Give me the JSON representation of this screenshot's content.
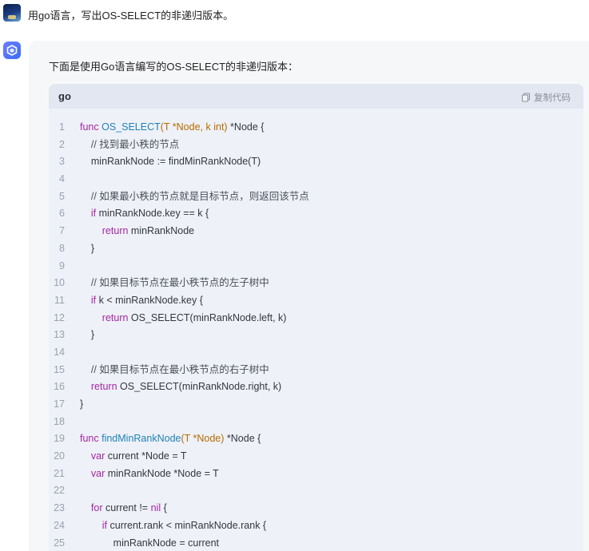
{
  "user": {
    "message": "用go语言，写出OS-SELECT的非递归版本。"
  },
  "assistant": {
    "intro": "下面是使用Go语言编写的OS-SELECT的非递归版本："
  },
  "code": {
    "language": "go",
    "copy_label": "复制代码",
    "lines": [
      {
        "n": "1",
        "tokens": [
          [
            "kw",
            "func "
          ],
          [
            "fn",
            "OS_SELECT"
          ],
          [
            "ty",
            "(T *Node, k int)"
          ],
          [
            "pl",
            " *Node {"
          ]
        ]
      },
      {
        "n": "2",
        "tokens": [
          [
            "cm",
            "    // 找到最小秩的节点"
          ]
        ]
      },
      {
        "n": "3",
        "tokens": [
          [
            "pl",
            "    minRankNode := findMinRankNode(T)"
          ]
        ]
      },
      {
        "n": "4",
        "tokens": [
          [
            "pl",
            ""
          ]
        ]
      },
      {
        "n": "5",
        "tokens": [
          [
            "cm",
            "    // 如果最小秩的节点就是目标节点，则返回该节点"
          ]
        ]
      },
      {
        "n": "6",
        "tokens": [
          [
            "kw",
            "    if"
          ],
          [
            "pl",
            " minRankNode.key == k {"
          ]
        ]
      },
      {
        "n": "7",
        "tokens": [
          [
            "kw",
            "        return"
          ],
          [
            "pl",
            " minRankNode"
          ]
        ]
      },
      {
        "n": "8",
        "tokens": [
          [
            "pl",
            "    }"
          ]
        ]
      },
      {
        "n": "9",
        "tokens": [
          [
            "pl",
            ""
          ]
        ]
      },
      {
        "n": "10",
        "tokens": [
          [
            "cm",
            "    // 如果目标节点在最小秩节点的左子树中"
          ]
        ]
      },
      {
        "n": "11",
        "tokens": [
          [
            "kw",
            "    if"
          ],
          [
            "pl",
            " k < minRankNode.key {"
          ]
        ]
      },
      {
        "n": "12",
        "tokens": [
          [
            "kw",
            "        return"
          ],
          [
            "pl",
            " OS_SELECT(minRankNode.left, k)"
          ]
        ]
      },
      {
        "n": "13",
        "tokens": [
          [
            "pl",
            "    }"
          ]
        ]
      },
      {
        "n": "14",
        "tokens": [
          [
            "pl",
            ""
          ]
        ]
      },
      {
        "n": "15",
        "tokens": [
          [
            "cm",
            "    // 如果目标节点在最小秩节点的右子树中"
          ]
        ]
      },
      {
        "n": "16",
        "tokens": [
          [
            "kw",
            "    return"
          ],
          [
            "pl",
            " OS_SELECT(minRankNode.right, k)"
          ]
        ]
      },
      {
        "n": "17",
        "tokens": [
          [
            "pl",
            "}"
          ]
        ]
      },
      {
        "n": "18",
        "tokens": [
          [
            "pl",
            ""
          ]
        ]
      },
      {
        "n": "19",
        "tokens": [
          [
            "kw",
            "func "
          ],
          [
            "fn",
            "findMinRankNode"
          ],
          [
            "ty",
            "(T *Node)"
          ],
          [
            "pl",
            " *Node {"
          ]
        ]
      },
      {
        "n": "20",
        "tokens": [
          [
            "kw",
            "    var"
          ],
          [
            "pl",
            " current *Node = T"
          ]
        ]
      },
      {
        "n": "21",
        "tokens": [
          [
            "kw",
            "    var"
          ],
          [
            "pl",
            " minRankNode *Node = T"
          ]
        ]
      },
      {
        "n": "22",
        "tokens": [
          [
            "pl",
            ""
          ]
        ]
      },
      {
        "n": "23",
        "tokens": [
          [
            "kw",
            "    for"
          ],
          [
            "pl",
            " current != "
          ],
          [
            "kw",
            "nil"
          ],
          [
            "pl",
            " {"
          ]
        ]
      },
      {
        "n": "24",
        "tokens": [
          [
            "kw",
            "        if"
          ],
          [
            "pl",
            " current.rank < minRankNode.rank {"
          ]
        ]
      },
      {
        "n": "25",
        "tokens": [
          [
            "pl",
            "            minRankNode = current"
          ]
        ]
      }
    ]
  }
}
